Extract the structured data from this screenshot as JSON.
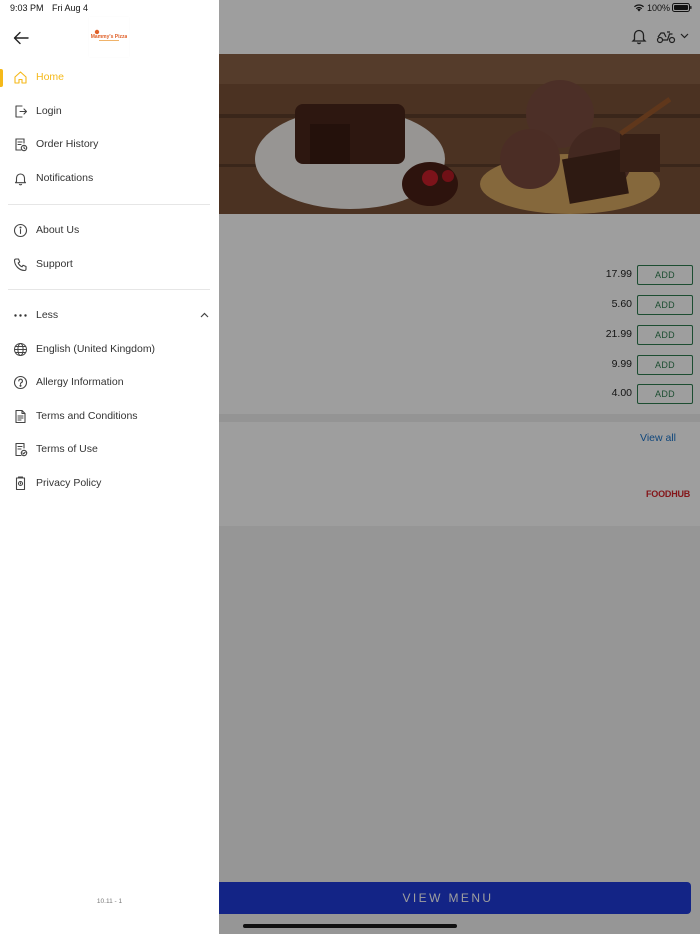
{
  "status_bar": {
    "time": "9:03 PM",
    "date": "Fri Aug 4",
    "battery": "100%"
  },
  "background": {
    "icons": [
      "bell-icon",
      "scooter-icon",
      "chevron-down-icon"
    ],
    "prices": [
      "17.99",
      "5.60",
      "21.99",
      "9.99",
      "4.00"
    ],
    "add_label": "ADD",
    "view_all": "View all",
    "brand": "FOODHUB",
    "view_menu": "VIEW MENU"
  },
  "drawer": {
    "logo_text": "Mammy's Pizza",
    "primary_items": [
      {
        "label": "Home",
        "icon": "home-icon",
        "active": true
      },
      {
        "label": "Login",
        "icon": "login-icon"
      },
      {
        "label": "Order History",
        "icon": "order-history-icon"
      },
      {
        "label": "Notifications",
        "icon": "bell-icon"
      }
    ],
    "secondary_items": [
      {
        "label": "About Us",
        "icon": "info-icon"
      },
      {
        "label": "Support",
        "icon": "phone-icon"
      }
    ],
    "more_toggle": {
      "label": "Less",
      "icon": "more-dots-icon"
    },
    "more_items": [
      {
        "label": "English (United Kingdom)",
        "icon": "globe-icon"
      },
      {
        "label": "Allergy Information",
        "icon": "question-icon"
      },
      {
        "label": "Terms and Conditions",
        "icon": "document-icon"
      },
      {
        "label": "Terms of Use",
        "icon": "document-check-icon"
      },
      {
        "label": "Privacy Policy",
        "icon": "privacy-icon"
      }
    ],
    "version": "10.11 - 1"
  },
  "colors": {
    "accent": "#f5b91a",
    "add_green": "#2e7d4f",
    "view_menu_blue": "#1f3bd8",
    "link_blue": "#1a73c8",
    "brand_red": "#d6242b"
  }
}
